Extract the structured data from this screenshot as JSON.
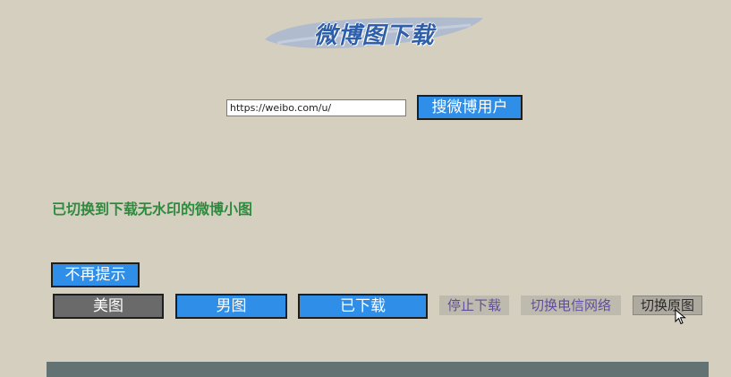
{
  "header": {
    "logo_text": "微博图下载"
  },
  "search": {
    "url_value": "https://weibo.com/u/",
    "search_label": "搜微博用户"
  },
  "notice": {
    "text": "已切换到下载无水印的微博小图"
  },
  "actions": {
    "dismiss_label": "不再提示"
  },
  "categories": [
    {
      "label": "美图",
      "active": true
    },
    {
      "label": "男图",
      "active": false
    },
    {
      "label": "已下载",
      "active": false
    }
  ],
  "tools": {
    "stop_label": "停止下载",
    "network_label": "切换电信网络",
    "original_label": "切换原图"
  },
  "colors": {
    "background": "#d4cfbf",
    "button_blue": "#2e8ee8",
    "active_gray": "#6a6a6a",
    "notice_green": "#2e8b3e",
    "link_purple": "#5e4f9c",
    "footer_bar": "#637373"
  }
}
